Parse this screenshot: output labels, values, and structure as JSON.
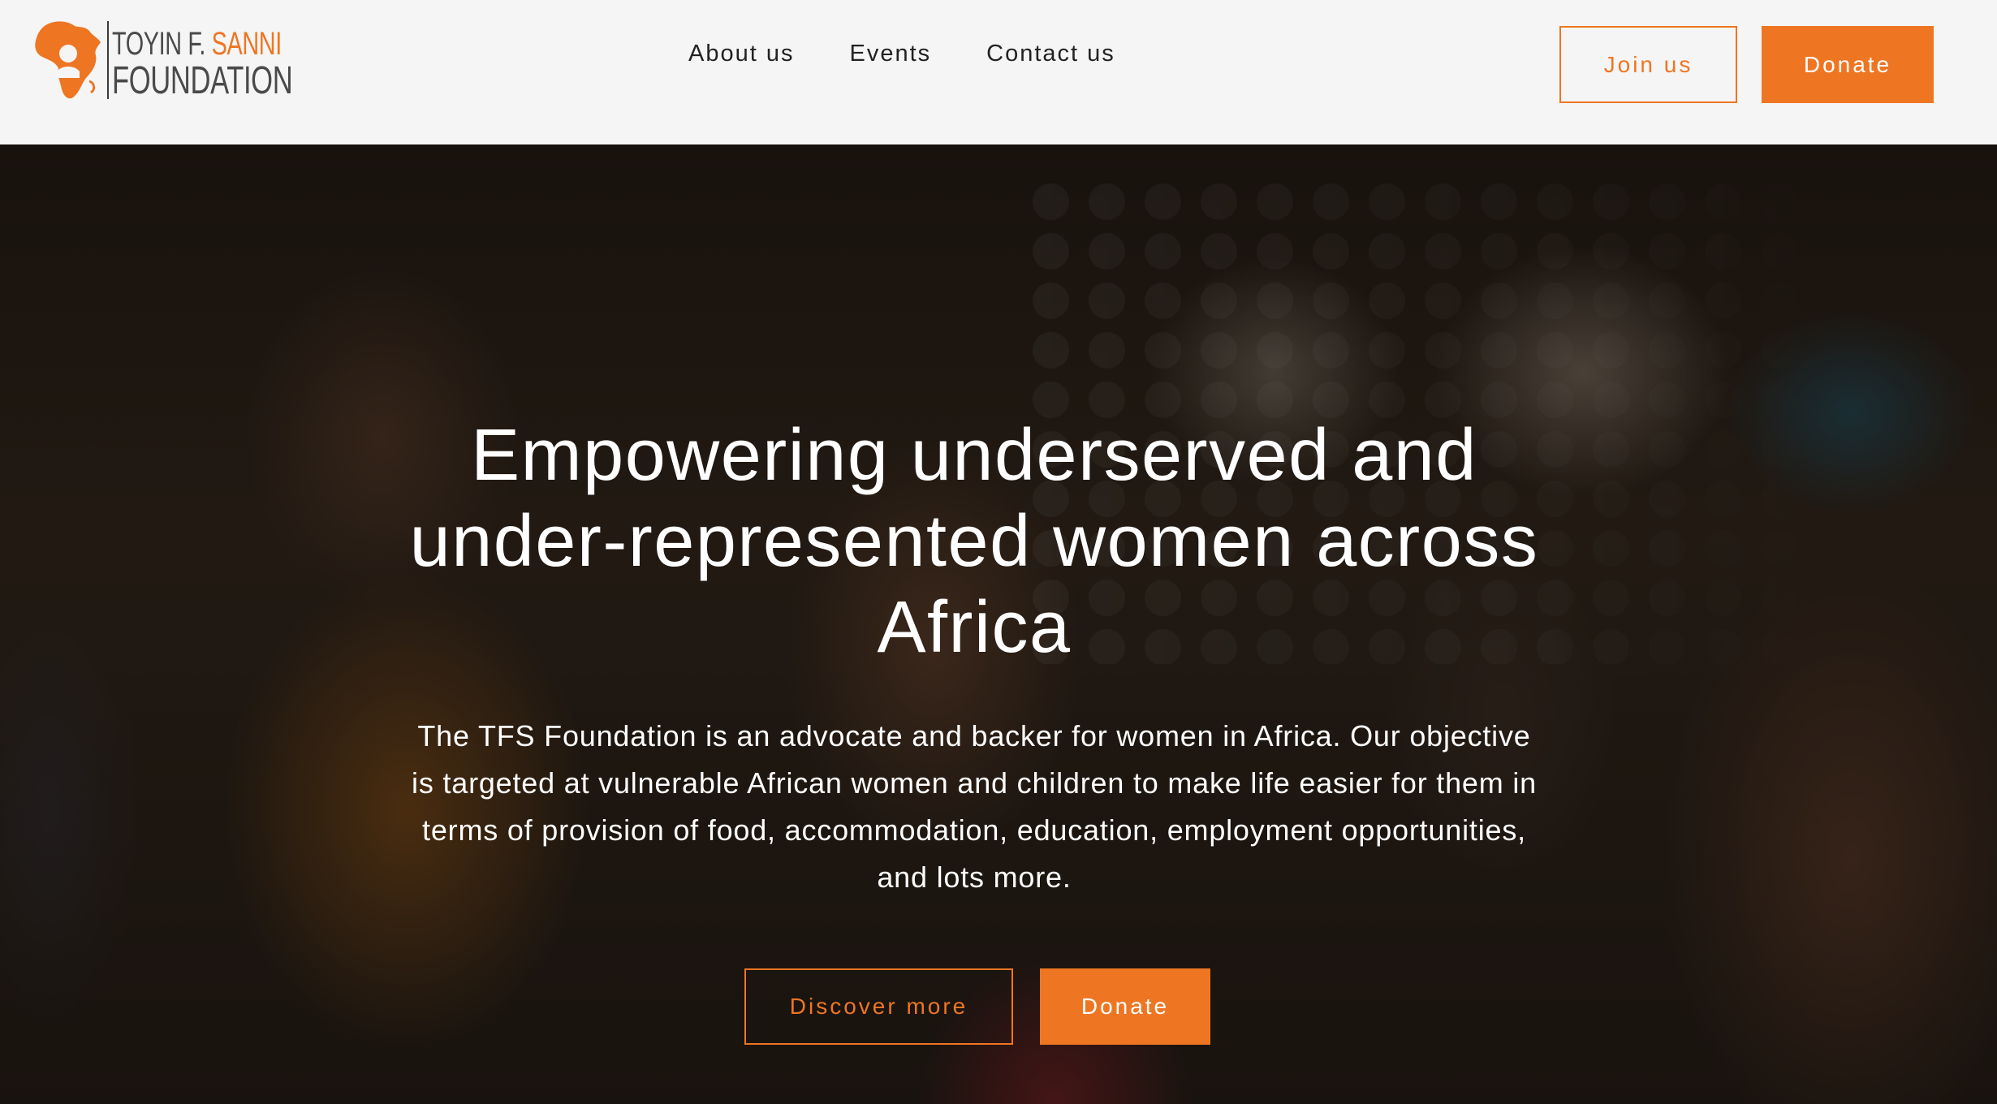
{
  "brand": {
    "logo_line1_prefix": "TOYIN F. ",
    "logo_line1_accent": "SANNI",
    "logo_line2": "FOUNDATION",
    "accent_color": "#ee7623",
    "icon": "africa-map-icon"
  },
  "nav": {
    "items": [
      {
        "label": "About us"
      },
      {
        "label": "Events"
      },
      {
        "label": "Contact us"
      }
    ]
  },
  "header_actions": {
    "join_label": "Join us",
    "donate_label": "Donate"
  },
  "hero": {
    "title": "Empowering underserved and under-represented women across Africa",
    "description": "The TFS Foundation is an advocate and backer for women in Africa. Our objective is targeted at vulnerable African women and children to make life easier for them in terms of provision of food, accommodation, education, employment opportunities, and lots more.",
    "discover_label": "Discover more",
    "donate_label": "Donate"
  }
}
